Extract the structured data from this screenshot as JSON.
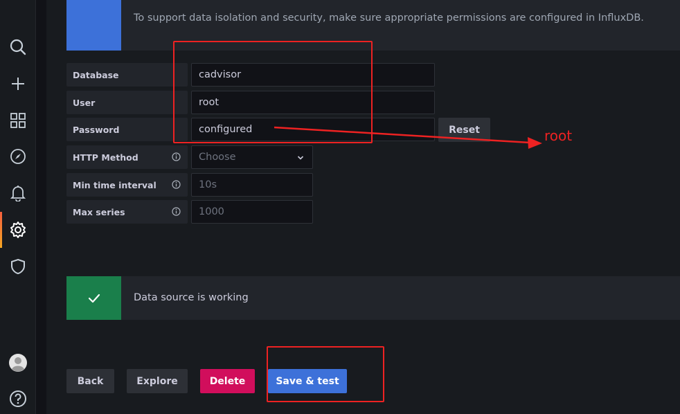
{
  "nav": {
    "items": [
      {
        "name": "search",
        "icon": "search-icon"
      },
      {
        "name": "create",
        "icon": "plus-icon"
      },
      {
        "name": "dashboards",
        "icon": "grid-icon"
      },
      {
        "name": "explore",
        "icon": "compass-icon"
      },
      {
        "name": "alerting",
        "icon": "bell-icon"
      },
      {
        "name": "configuration",
        "icon": "gear-icon",
        "active": true
      },
      {
        "name": "server-admin",
        "icon": "shield-icon"
      },
      {
        "name": "profile",
        "icon": "avatar"
      },
      {
        "name": "help",
        "icon": "help-icon"
      }
    ]
  },
  "info_alert": {
    "text": "To support data isolation and security, make sure appropriate permissions are configured in InfluxDB."
  },
  "form": {
    "database": {
      "label": "Database",
      "value": "cadvisor"
    },
    "user": {
      "label": "User",
      "value": "root"
    },
    "password": {
      "label": "Password",
      "value": "configured",
      "reset_label": "Reset"
    },
    "http_method": {
      "label": "HTTP Method",
      "placeholder": "Choose"
    },
    "min_interval": {
      "label": "Min time interval",
      "placeholder": "10s"
    },
    "max_series": {
      "label": "Max series",
      "placeholder": "1000"
    }
  },
  "success_alert": {
    "text": "Data source is working"
  },
  "actions": {
    "back": "Back",
    "explore": "Explore",
    "delete": "Delete",
    "save": "Save & test"
  },
  "annotation": {
    "text": "root",
    "color": "#ee2222"
  },
  "colors": {
    "primary": "#3d71d9",
    "success": "#1a7f4b",
    "danger": "#d10e5c",
    "background": "#181b1f"
  }
}
